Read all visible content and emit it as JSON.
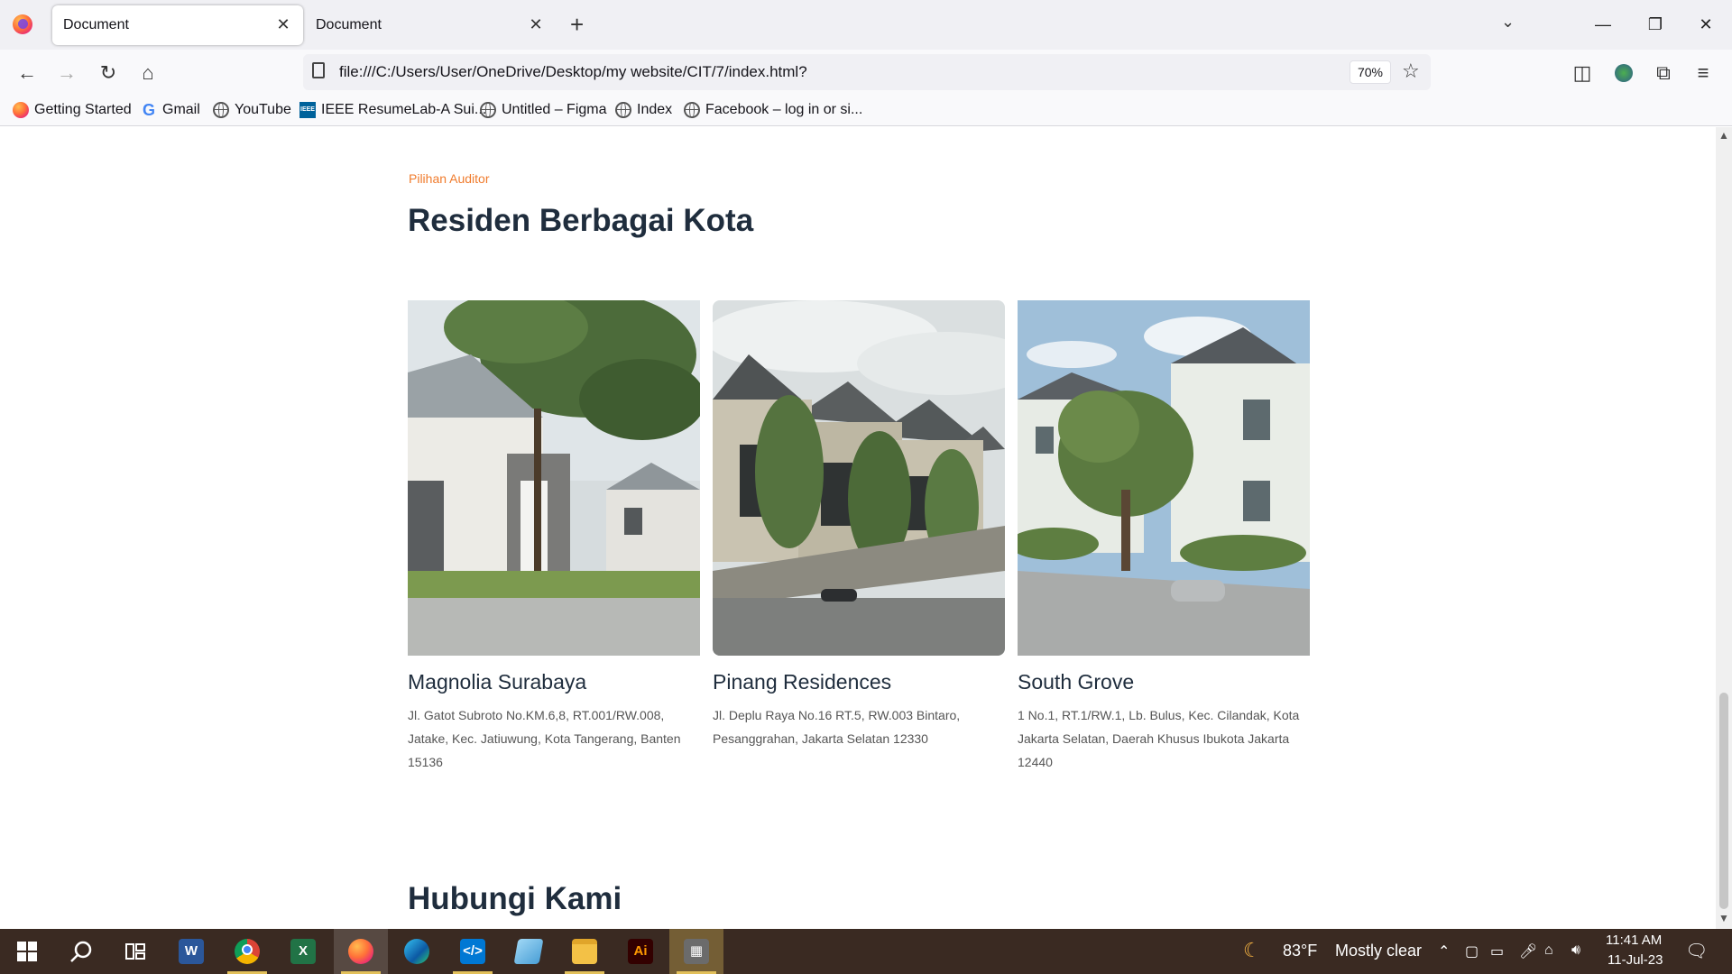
{
  "browser": {
    "tabs": [
      {
        "title": "Document",
        "active": true
      },
      {
        "title": "Document",
        "active": false
      }
    ],
    "url": "file:///C:/Users/User/OneDrive/Desktop/my website/CIT/7/index.html?",
    "zoom": "70%",
    "bookmarks": [
      {
        "label": "Getting Started",
        "icon": "firefox-icon"
      },
      {
        "label": "Gmail",
        "icon": "google-icon"
      },
      {
        "label": "YouTube",
        "icon": "globe-icon"
      },
      {
        "label": "IEEE ResumeLab-A Sui...",
        "icon": "ieee-icon"
      },
      {
        "label": "Untitled – Figma",
        "icon": "globe-icon"
      },
      {
        "label": "Index",
        "icon": "globe-icon"
      },
      {
        "label": "Facebook – log in or si...",
        "icon": "globe-icon"
      }
    ]
  },
  "page": {
    "kicker": "Pilihan Auditor",
    "heading": "Residen Berbagai Kota",
    "cards": [
      {
        "title": "Magnolia Surabaya",
        "address": "Jl. Gatot Subroto No.KM.6,8, RT.001/RW.008, Jatake, Kec. Jatiuwung, Kota Tangerang, Banten 15136"
      },
      {
        "title": "Pinang Residences",
        "address": "Jl. Deplu Raya No.16 RT.5, RW.003 Bintaro, Pesanggrahan, Jakarta Selatan 12330"
      },
      {
        "title": "South Grove",
        "address": "1 No.1, RT.1/RW.1, Lb. Bulus, Kec. Cilandak, Kota Jakarta Selatan, Daerah Khusus Ibukota Jakarta 12440"
      }
    ],
    "next_section": "Hubungi Kami"
  },
  "taskbar": {
    "weather": "83°F",
    "weather_desc": "Mostly clear",
    "time": "11:41 AM",
    "date": "11-Jul-23",
    "apps": [
      "start-icon",
      "search-icon",
      "task-view-icon",
      "word-icon",
      "chrome-icon",
      "excel-icon",
      "firefox-icon",
      "edge-icon",
      "vscode-icon",
      "notepad-icon",
      "file-explorer-icon",
      "illustrator-icon",
      "calculator-icon"
    ]
  }
}
